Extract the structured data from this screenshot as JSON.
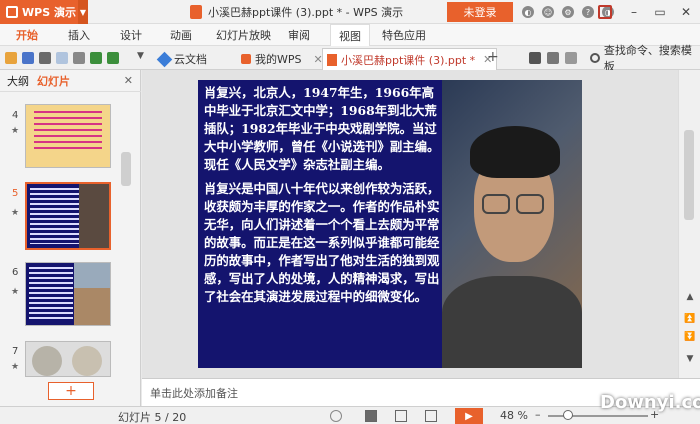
{
  "titlebar": {
    "app_button": "WPS 演示",
    "doc_title": "小溪巴赫ppt课件 (3).ppt * - WPS 演示",
    "login": "未登录"
  },
  "menu": {
    "items": [
      "开始",
      "插入",
      "设计",
      "动画",
      "幻灯片放映",
      "审阅",
      "视图",
      "特色应用"
    ]
  },
  "toolbar": {
    "tabs": [
      "云文档",
      "我的WPS",
      "小溪巴赫ppt课件 (3).ppt *"
    ],
    "search": "查找命令、搜索模板"
  },
  "left_panel": {
    "tabs": [
      "大纲",
      "幻灯片"
    ],
    "slide_numbers": [
      "4",
      "5",
      "6",
      "7"
    ],
    "add_label": "+"
  },
  "slide": {
    "paragraph1": "肖复兴，北京人，1947年生，1966年高中毕业于北京汇文中学；1968年到北大荒插队；1982年毕业于中央戏剧学院。当过大中小学教师，曾任《小说选刊》副主编。现任《人民文学》杂志社副主编。",
    "paragraph2": "肖复兴是中国八十年代以来创作较为活跃，收获颇为丰厚的作家之一。作者的作品朴实无华，向人们讲述着一个个看上去颇为平常的故事。而正是在这一系列似乎谁都可能经历的故事中，作者写出了他对生活的独到观感，写出了人的处境，人的精神渴求，写出了社会在其演进发展过程中的细微变化。"
  },
  "notes": "单击此处添加备注",
  "status": {
    "page": "幻灯片 5 / 20",
    "zoom": "48 %",
    "zoom_level": 0.48
  },
  "watermark": "Downyi.com",
  "colors": {
    "accent": "#e8612c",
    "slide_bg": "#14146e"
  }
}
